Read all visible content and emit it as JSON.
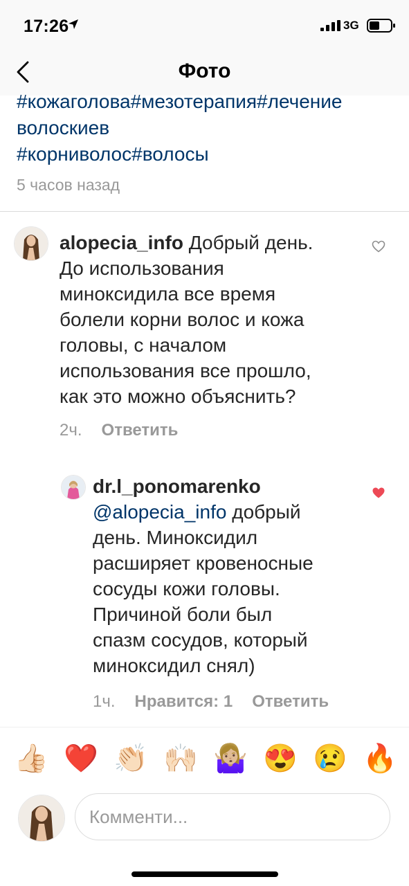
{
  "status": {
    "time": "17:26",
    "network": "3G"
  },
  "nav": {
    "title": "Фото"
  },
  "caption": {
    "lines": [
      "#кожаголова#мезотерапия#лечение",
      "волоскиев",
      "#корниволос#волосы"
    ],
    "time": "5 часов назад"
  },
  "comment1": {
    "username": "alopecia_info",
    "first_line_text": " Добрый день.",
    "lines": [
      "До использования",
      "миноксидила все время",
      "болели корни волос и кожа",
      "головы, с началом",
      "использования все прошло,",
      "как это можно объяснить?"
    ],
    "age": "2ч.",
    "reply_label": "Ответить",
    "liked": false
  },
  "reply1": {
    "username": "dr.l_ponomarenko",
    "mention": "@alopecia_info",
    "mention_tail": " добрый",
    "lines": [
      "день. Миноксидил",
      "расширяет кровеносные",
      "сосуды кожи головы.",
      "Причиной боли был",
      "спазм сосудов, который",
      "миноксидил снял)"
    ],
    "age": "1ч.",
    "likes_label": "Нравится: 1",
    "reply_label": "Ответить",
    "liked": true,
    "heart_color": "#ed4956"
  },
  "emoji_bar": [
    "👍🏻",
    "❤️",
    "👏🏻",
    "🙌🏻",
    "🤷🏼‍♀️",
    "😍",
    "😢",
    "🔥"
  ],
  "input": {
    "placeholder": "Комменти..."
  },
  "colors": {
    "link": "#003569",
    "meta": "#999999",
    "divider": "#dbdbdb"
  }
}
